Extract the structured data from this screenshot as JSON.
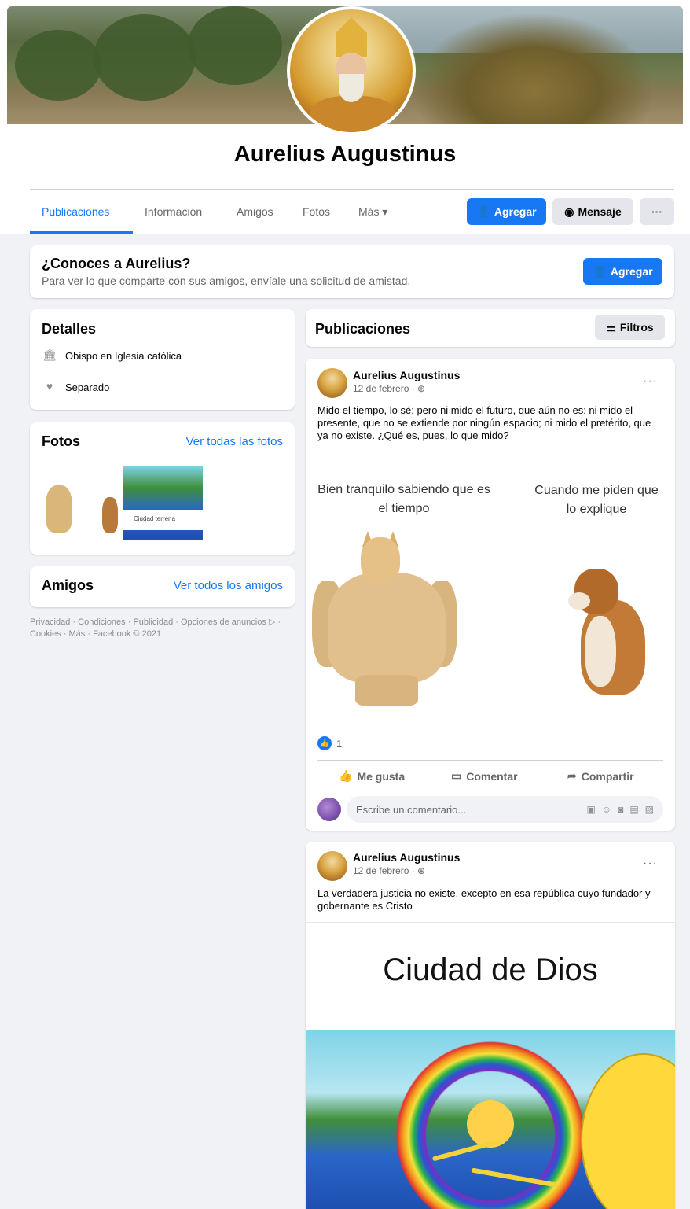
{
  "profile": {
    "name": "Aurelius Augustinus"
  },
  "nav": {
    "tabs": [
      {
        "label": "Publicaciones",
        "active": true
      },
      {
        "label": "Información"
      },
      {
        "label": "Amigos"
      },
      {
        "label": "Fotos"
      },
      {
        "label": "Más ▾"
      }
    ],
    "add_label": "Agregar",
    "message_label": "Mensaje",
    "more_label": "···"
  },
  "know": {
    "title": "¿Conoces a Aurelius?",
    "subtitle": "Para ver lo que comparte con sus amigos, envíale una solicitud de amistad.",
    "add_label": "Agregar"
  },
  "details": {
    "title": "Detalles",
    "items": [
      {
        "icon": "briefcase-icon",
        "text": "Obispo en Iglesia católica"
      },
      {
        "icon": "heart-icon",
        "text": "Separado"
      }
    ]
  },
  "photos": {
    "title": "Fotos",
    "see_all": "Ver todas las fotos",
    "captions": [
      "Ciudad terrena"
    ]
  },
  "friends": {
    "title": "Amigos",
    "see_all": "Ver todos los amigos"
  },
  "footer": {
    "text": "Privacidad · Condiciones · Publicidad · Opciones de anuncios ▷ · Cookies · Más · Facebook © 2021"
  },
  "feed": {
    "title": "Publicaciones",
    "filters_label": "Filtros"
  },
  "posts": [
    {
      "author": "Aurelius Augustinus",
      "date": "12 de febrero · ⊕",
      "more": "···",
      "text": "Mido el tiempo, lo sé; pero ni mido el futuro, que aún no es; ni mido el presente, que no se extiende por ningún espacio; ni mido el pretérito, que ya no existe. ¿Qué es, pues, lo que mido?",
      "meme_left": "Bien tranquilo sabiendo que es el tiempo",
      "meme_right": "Cuando me piden que lo explique",
      "reaction_count": "1",
      "actions": {
        "like": "Me gusta",
        "comment": "Comentar",
        "share": "Compartir"
      },
      "comment_placeholder": "Escribe un comentario..."
    },
    {
      "author": "Aurelius Augustinus",
      "date": "12 de febrero · ⊕",
      "more": "···",
      "text": "La verdadera justicia no existe, excepto en esa república cuyo fundador y gobernante es Cristo",
      "meme_title": "Ciudad de Dios"
    }
  ],
  "colors": {
    "accent": "#1877f2",
    "background": "#f0f2f5",
    "muted_text": "#65676b"
  }
}
